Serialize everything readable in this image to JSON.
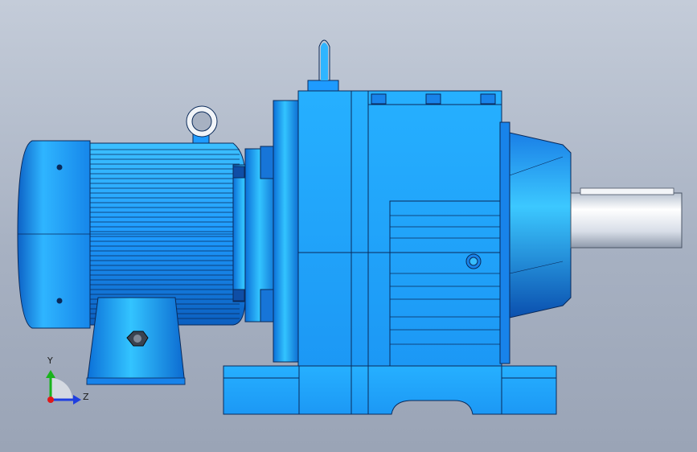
{
  "viewport": {
    "background_top": "#c4ccd9",
    "background_bottom": "#9aa4b6"
  },
  "model": {
    "name": "gear-reducer-with-motor",
    "primary_color": "#1e9bff",
    "highlight_color": "#22b6ff",
    "shadow_color": "#0b5fc0",
    "edge_color": "#0a2a5a",
    "shaft_color": "#e6ebf2"
  },
  "triad": {
    "x_axis_label": "",
    "y_axis_label": "Y",
    "z_axis_label": "Z",
    "y_color": "#19b31c",
    "z_color": "#1f3fe0",
    "x_color": "#e01919"
  }
}
